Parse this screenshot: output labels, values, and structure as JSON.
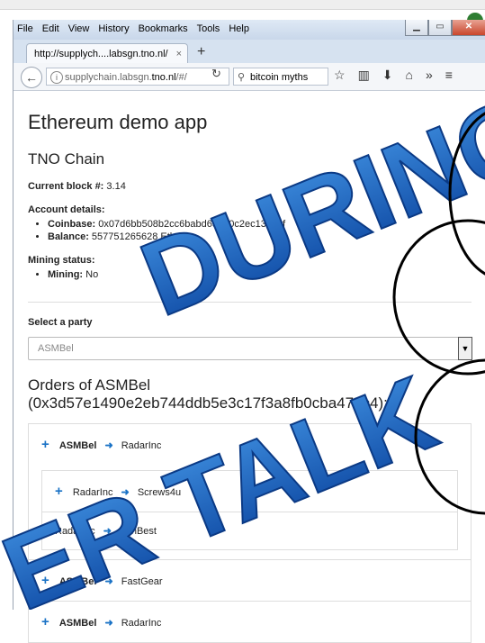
{
  "browser": {
    "menu": [
      "File",
      "Edit",
      "View",
      "History",
      "Bookmarks",
      "Tools",
      "Help"
    ],
    "tab_title": "http://supplych....labsgn.tno.nl/",
    "url_prefix": "supplychain.labsgn.",
    "url_host": "tno.nl",
    "url_suffix": "/#/",
    "search_text": "bitcoin myths"
  },
  "page": {
    "title": "Ethereum demo app",
    "chain": "TNO Chain",
    "current_block_label": "Current block #:",
    "current_block_value": "3.14",
    "account_label": "Account details:",
    "coinbase_label": "Coinbase:",
    "coinbase_value": "0x07d6bb508b2cc6babd63a70c2ec13513f",
    "balance_label": "Balance:",
    "balance_value": "557751265628 Ether",
    "mining_label": "Mining status:",
    "mining_key": "Mining:",
    "mining_value": "No",
    "select_label": "Select a party",
    "select_value": "ASMBel",
    "orders_heading": "Orders of ASMBel (0x3d57e1490e2eb744ddb5e3c17f3a8fb0cba475c4):"
  },
  "orders": [
    {
      "from": "ASMBel",
      "to": "RadarInc",
      "nested": [
        {
          "from": "RadarInc",
          "to": "Screws4u",
          "expandable": true
        },
        {
          "from": "RadarInc",
          "to": "IronBest",
          "expandable": false
        }
      ]
    },
    {
      "from": "ASMBel",
      "to": "FastGear"
    },
    {
      "from": "ASMBel",
      "to": "RadarInc"
    }
  ],
  "overlay": {
    "line1": "DURING",
    "line2": "ER TALK",
    "color": "#1565c0"
  }
}
